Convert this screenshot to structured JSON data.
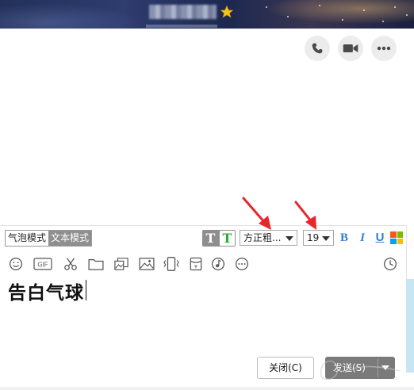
{
  "titlebar": {
    "contact_name": "██████",
    "star_icon": "star-icon"
  },
  "actions": {
    "icons": [
      "phone-icon",
      "video-icon",
      "more-icon"
    ]
  },
  "format_toolbar": {
    "mode_bubble": "气泡模式",
    "mode_text": "文本模式",
    "font": "方正粗...",
    "size": "19",
    "bold": "B",
    "italic": "I",
    "underline": "U",
    "tt_plain": "T",
    "tt_color": "T"
  },
  "tools": {
    "gif": "GIF",
    "icons": [
      "emoji-icon",
      "gif-icon",
      "scissors-icon",
      "folder-icon",
      "image-gallery-icon",
      "image-icon",
      "shake-icon",
      "red-packet-icon",
      "music-icon",
      "more-tools-icon",
      "history-icon"
    ]
  },
  "input": {
    "text": "告白气球"
  },
  "footer": {
    "close_label": "关闭(C)",
    "send_label": "发送(S)"
  },
  "colors": {
    "accent_blue": "#2f7fd4",
    "annotation_red": "#e8252a",
    "tt_green": "#2eaa2e"
  }
}
